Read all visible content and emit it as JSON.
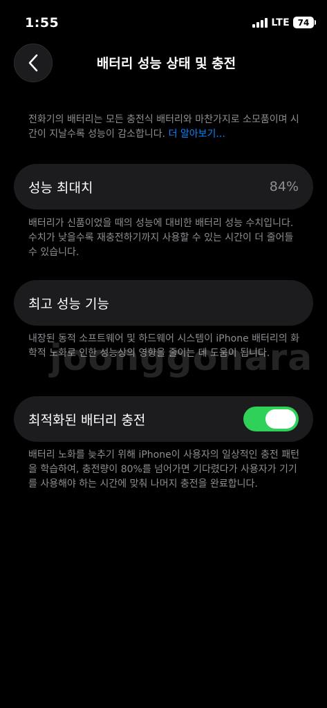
{
  "status_bar": {
    "time": "1:55",
    "network": "LTE",
    "battery_level": "74",
    "icons": [
      "signal-icon",
      "battery-icon"
    ]
  },
  "header": {
    "title": "배터리 성능 상태 및 충전",
    "back_icon": "chevron-left-icon"
  },
  "intro": {
    "text": "전화기의 배터리는 모든 충전식 배터리와 마찬가지로 소모품이며 시간이 지날수록 성능이 감소합니다.",
    "link": "더 알아보기..."
  },
  "max_capacity": {
    "label": "성능 최대치",
    "value": "84%",
    "description": "배터리가 신품이었을 때의 성능에 대비한 배터리 성능 수치입니다. 수치가 낮을수록 재충전하기까지 사용할 수 있는 시간이 더 줄어들 수 있습니다."
  },
  "peak_performance": {
    "label": "최고 성능 기능",
    "description": "내장된 동적 소프트웨어 및 하드웨어 시스템이 iPhone 배터리의 화학적 노화로 인한 성능상의 영향을 줄이는 데 도움이 됩니다."
  },
  "optimized_charging": {
    "label": "최적화된 배터리 충전",
    "enabled": true,
    "description": "배터리 노화를 늦추기 위해 iPhone이 사용자의 일상적인 충전 패턴을 학습하여, 충전량이 80%를 넘어가면 기다렸다가 사용자가 기기를 사용해야 하는 시간에 맞춰 나머지 충전을 완료합니다."
  },
  "watermark": "joonggonara",
  "colors": {
    "background": "#000000",
    "card": "#1c1c1e",
    "secondary_text": "#8e8e93",
    "link": "#0a84ff",
    "toggle_on": "#30d158"
  }
}
